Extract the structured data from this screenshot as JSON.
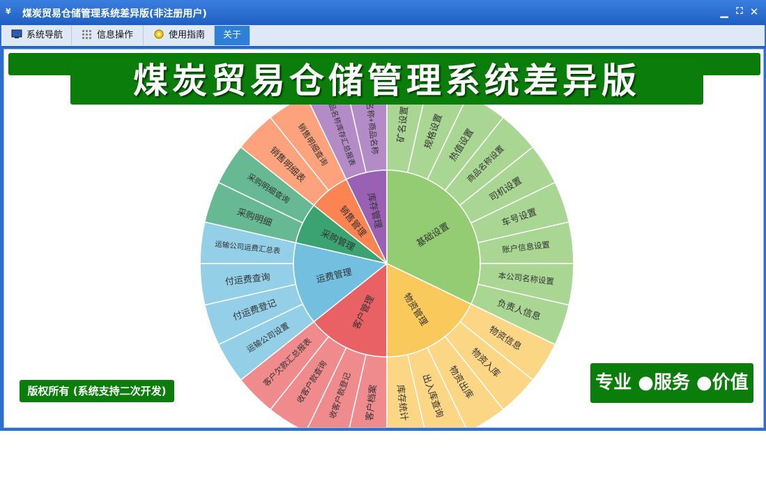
{
  "window": {
    "title": "煤炭贸易仓储管理系统差异版(非注册用户)",
    "app_icon": "¥",
    "minimize": "▁",
    "restore": "⛶",
    "close": "✕"
  },
  "menu": {
    "tabs": [
      {
        "label": "系统导航",
        "icon": "monitor-icon",
        "active": false
      },
      {
        "label": "信息操作",
        "icon": "grid-icon",
        "active": false
      },
      {
        "label": "使用指南",
        "icon": "lightbulb-icon",
        "active": false
      },
      {
        "label": "关于",
        "icon": "",
        "active": true
      }
    ]
  },
  "banner": {
    "title": "煤炭贸易仓储管理系统差异版"
  },
  "footer": {
    "copyright": "版权所有 (系统支持二次开发)",
    "slogan": "专业 ●服务 ●价值"
  },
  "colors": {
    "window_blue": "#2d6fd0",
    "banner_green": "#0a7d0a",
    "active_tab": "#2e7fd8"
  },
  "sunburst": {
    "inner": [
      {
        "label": "基础设置",
        "color": "#93cc72",
        "children": [
          {
            "label": "矿名设置",
            "color": "#a9d693"
          },
          {
            "label": "规格设置",
            "color": "#a9d693"
          },
          {
            "label": "热值设置",
            "color": "#a9d693"
          },
          {
            "label": "商品名称设置",
            "color": "#a9d693"
          },
          {
            "label": "司机设置",
            "color": "#a9d693"
          },
          {
            "label": "车号设置",
            "color": "#a9d693"
          },
          {
            "label": "账户信息设置",
            "color": "#a9d693"
          },
          {
            "label": "本公司名称设置",
            "color": "#a9d693"
          },
          {
            "label": "负责人信息",
            "color": "#a9d693"
          }
        ]
      },
      {
        "label": "物资管理",
        "color": "#f9c95c",
        "children": [
          {
            "label": "物资信息",
            "color": "#fbd684"
          },
          {
            "label": "物资入库",
            "color": "#fbd684"
          },
          {
            "label": "物资出库",
            "color": "#fbd684"
          },
          {
            "label": "出入库查询",
            "color": "#fbd684"
          },
          {
            "label": "库存统计",
            "color": "#fbd684"
          }
        ]
      },
      {
        "label": "客户管理",
        "color": "#e96065",
        "children": [
          {
            "label": "客户档案",
            "color": "#ef8a8d"
          },
          {
            "label": "收客户款登记",
            "color": "#ef8a8d"
          },
          {
            "label": "收客户款查询",
            "color": "#ef8a8d"
          },
          {
            "label": "客户欠款汇总报表",
            "color": "#ef8a8d"
          }
        ]
      },
      {
        "label": "运费管理",
        "color": "#73bfe0",
        "children": [
          {
            "label": "运输公司设置",
            "color": "#93cfe7"
          },
          {
            "label": "付运费登记",
            "color": "#93cfe7"
          },
          {
            "label": "付运费查询",
            "color": "#93cfe7"
          },
          {
            "label": "运输公司运费汇总表",
            "color": "#93cfe7"
          }
        ]
      },
      {
        "label": "采购管理",
        "color": "#3ba272",
        "children": [
          {
            "label": "采购明细",
            "color": "#67b993"
          },
          {
            "label": "采购明细查询",
            "color": "#67b993"
          }
        ]
      },
      {
        "label": "销售管理",
        "color": "#fc8452",
        "children": [
          {
            "label": "销售明细表",
            "color": "#fca27c"
          },
          {
            "label": "销售明细查询",
            "color": "#fca27c"
          }
        ]
      },
      {
        "label": "库存管理",
        "color": "#9a60b4",
        "children": [
          {
            "label": "商品名称库存汇总报表",
            "color": "#b38bc7"
          },
          {
            "label": "矿名称+商品名称",
            "color": "#b38bc7"
          }
        ]
      }
    ]
  }
}
